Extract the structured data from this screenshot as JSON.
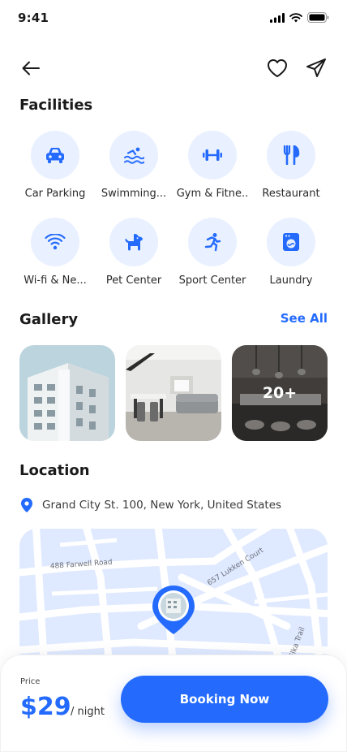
{
  "status": {
    "time": "9:41"
  },
  "facilities": {
    "title": "Facilities",
    "items": [
      {
        "label": "Car Parking",
        "icon": "car-icon"
      },
      {
        "label": "Swimming...",
        "icon": "swimming-icon"
      },
      {
        "label": "Gym & Fitne..",
        "icon": "dumbbell-icon"
      },
      {
        "label": "Restaurant",
        "icon": "fork-knife-icon"
      },
      {
        "label": "Wi-fi & Ne...",
        "icon": "wifi-icon"
      },
      {
        "label": "Pet Center",
        "icon": "dog-icon"
      },
      {
        "label": "Sport Center",
        "icon": "running-icon"
      },
      {
        "label": "Laundry",
        "icon": "washing-machine-icon"
      }
    ]
  },
  "gallery": {
    "title": "Gallery",
    "see_all": "See All",
    "more_count": "20+"
  },
  "location": {
    "title": "Location",
    "address": "Grand City St. 100, New York, United States",
    "map_labels": {
      "road1": "488 Farwell Road",
      "road2": "657 Lukken Court",
      "road3": "Elka Trail"
    }
  },
  "booking": {
    "price_caption": "Price",
    "price": "$29",
    "unit": "/ night",
    "button": "Booking Now"
  },
  "colors": {
    "accent": "#246bfd",
    "icon_bg": "#e9f0ff",
    "map_bg": "#dfe9ff"
  }
}
